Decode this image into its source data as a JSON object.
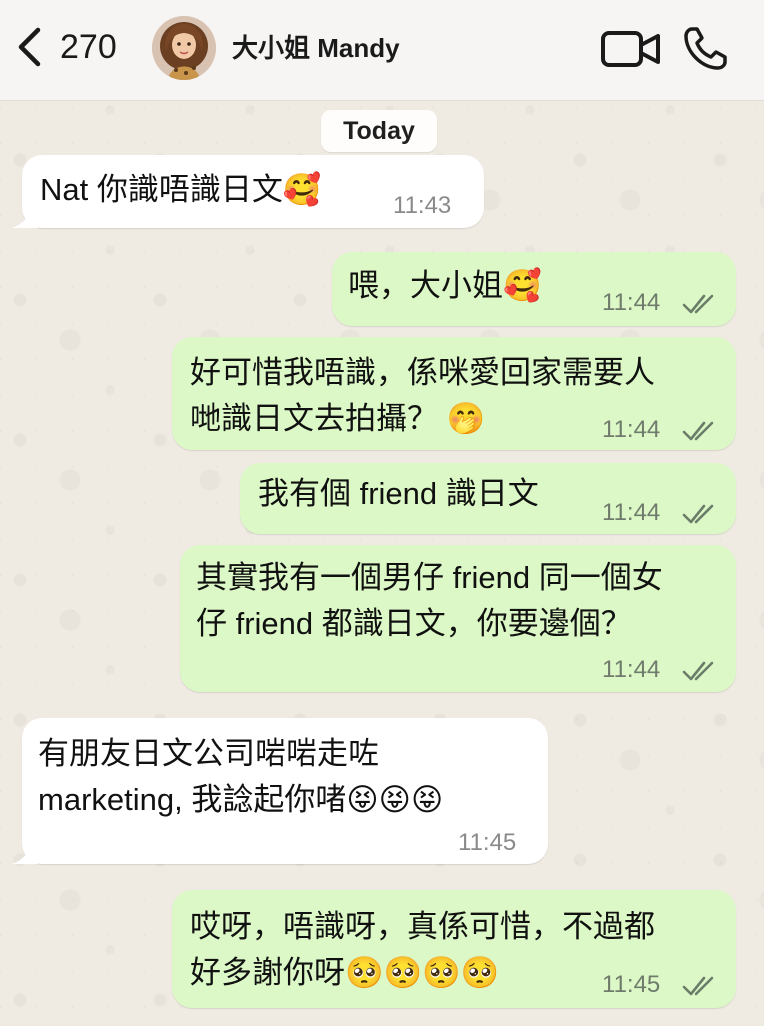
{
  "header": {
    "back_icon": "chevron-left-icon",
    "unread_count": "270",
    "contact_name": "大小姐 Mandy",
    "video_icon": "video-camera-icon",
    "phone_icon": "phone-icon"
  },
  "date_chip": "Today",
  "messages": [
    {
      "dir": "in",
      "text": "Nat 你識唔識日文🥰",
      "time": "11:43"
    },
    {
      "dir": "out",
      "text": "喂，大小姐🥰",
      "time": "11:44",
      "status": "read"
    },
    {
      "dir": "out",
      "text": "好可惜我唔識，係咪愛回家需要人\n哋識日文去拍攝？ 🤭",
      "time": "11:44",
      "status": "read"
    },
    {
      "dir": "out",
      "text": "我有個 friend 識日文",
      "time": "11:44",
      "status": "read"
    },
    {
      "dir": "out",
      "text": "其實我有一個男仔 friend 同一個女\n仔 friend 都識日文，你要邊個？",
      "time": "11:44",
      "status": "read"
    },
    {
      "dir": "in",
      "text": "有朋友日文公司啱啱走咗\nmarketing, 我諗起你啫😝😝😝",
      "time": "11:45"
    },
    {
      "dir": "out",
      "text": "哎呀，唔識呀，真係可惜，不過都\n好多謝你呀🥺🥺🥺🥺",
      "time": "11:45",
      "status": "read"
    }
  ],
  "colors": {
    "incoming_bubble": "#ffffff",
    "outgoing_bubble": "#dcf8c6",
    "read_ticks": "#6b7d69",
    "wallpaper": "#efeae2"
  }
}
